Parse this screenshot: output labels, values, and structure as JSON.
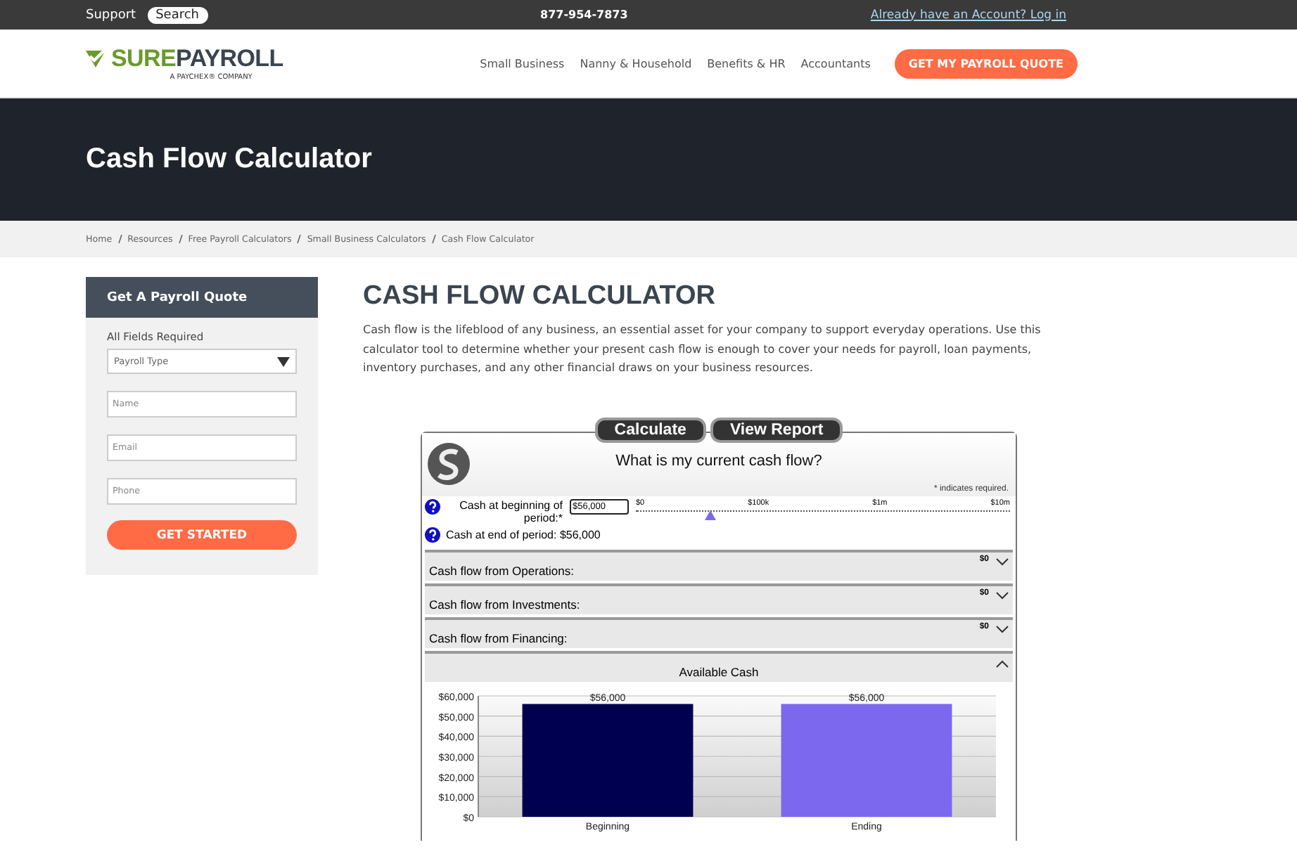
{
  "top_bar": {
    "support": "Support",
    "search": "Search",
    "phone": "877-954-7873",
    "login_link": "Already have an Account? Log in"
  },
  "header": {
    "logo": {
      "brand_first": "SURE",
      "brand_second": "PAYROLL",
      "tagline": "A PAYCHEX® COMPANY"
    },
    "nav": [
      "Small Business",
      "Nanny & Household",
      "Benefits & HR",
      "Accountants"
    ],
    "cta": "GET MY PAYROLL QUOTE"
  },
  "hero": {
    "title": "Cash Flow Calculator"
  },
  "breadcrumb": [
    "Home",
    "Resources",
    "Free Payroll Calculators",
    "Small Business Calculators",
    "Cash Flow Calculator"
  ],
  "sidebar": {
    "title": "Get A Payroll Quote",
    "required_note": "All Fields Required",
    "payroll_type": {
      "placeholder": "Payroll Type"
    },
    "fields": [
      {
        "placeholder": "Name"
      },
      {
        "placeholder": "Email"
      },
      {
        "placeholder": "Phone"
      }
    ],
    "button": "GET STARTED"
  },
  "main": {
    "heading": "CASH FLOW CALCULATOR",
    "intro": "Cash flow is the lifeblood of any business, an essential asset for your company to support everyday operations. Use this calculator tool to determine whether your present cash flow is enough to cover your needs for payroll, loan payments, inventory purchases, and any other financial draws on your business resources."
  },
  "calculator": {
    "buttons": [
      "Calculate",
      "View Report"
    ],
    "question": "What is my current cash flow?",
    "required_note": "* indicates required.",
    "input": {
      "label": "Cash at beginning of period:",
      "required_mark": "*",
      "value": "$56,000"
    },
    "slider": {
      "ticks": [
        "$0",
        "$100k",
        "$1m",
        "$10m"
      ],
      "level": 0.2
    },
    "end_text": "Cash at end of period: $56,000",
    "sections": [
      {
        "label": "Cash flow from Operations:",
        "value": "$0",
        "expanded": false
      },
      {
        "label": "Cash flow from Investments:",
        "value": "$0",
        "expanded": false
      },
      {
        "label": "Cash flow from Financing:",
        "value": "$0",
        "expanded": false
      }
    ],
    "available": {
      "title": "Available Cash",
      "expanded": true,
      "chart_data": {
        "type": "bar",
        "categories": [
          "Beginning",
          "Ending"
        ],
        "values": [
          56000,
          56000
        ],
        "colors": [
          "#000050",
          "#7b68ee"
        ],
        "data_labels": true,
        "value_labels": [
          "$56,000",
          "$56,000"
        ],
        "grid": true,
        "ylim": [
          0,
          60000
        ],
        "yticks": [
          {
            "value": 0,
            "label": "$0"
          },
          {
            "value": 10000,
            "label": "$10,000"
          },
          {
            "value": 20000,
            "label": "$20,000"
          },
          {
            "value": 30000,
            "label": "$30,000"
          },
          {
            "value": 40000,
            "label": "$40,000"
          },
          {
            "value": 50000,
            "label": "$50,000"
          },
          {
            "value": 60000,
            "label": "$60,000"
          }
        ]
      }
    }
  }
}
